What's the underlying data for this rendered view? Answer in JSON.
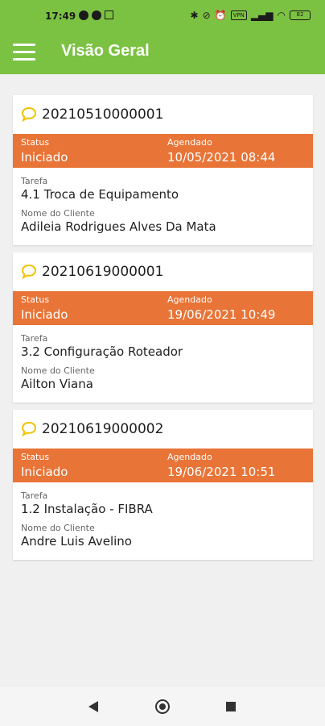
{
  "statusbar": {
    "time": "17:49",
    "battery": "82",
    "signal_badge": "VPN"
  },
  "appbar": {
    "title": "Visão Geral"
  },
  "labels": {
    "status": "Status",
    "agendado": "Agendado",
    "tarefa": "Tarefa",
    "cliente": "Nome do Cliente"
  },
  "colors": {
    "primary": "#7cc242",
    "band": "#e87437",
    "chat_icon": "#f2c200"
  },
  "orders": [
    {
      "id": "20210510000001",
      "status": "Iniciado",
      "agendado": "10/05/2021 08:44",
      "tarefa": "4.1 Troca de Equipamento",
      "cliente": "Adileia Rodrigues Alves Da Mata"
    },
    {
      "id": "20210619000001",
      "status": "Iniciado",
      "agendado": "19/06/2021 10:49",
      "tarefa": "3.2 Configuração Roteador",
      "cliente": "Ailton Viana"
    },
    {
      "id": "20210619000002",
      "status": "Iniciado",
      "agendado": "19/06/2021 10:51",
      "tarefa": "1.2 Instalação - FIBRA",
      "cliente": "Andre Luis Avelino"
    }
  ],
  "navbar": {
    "back": "back-icon",
    "home": "home-icon",
    "recent": "recent-apps-icon"
  }
}
